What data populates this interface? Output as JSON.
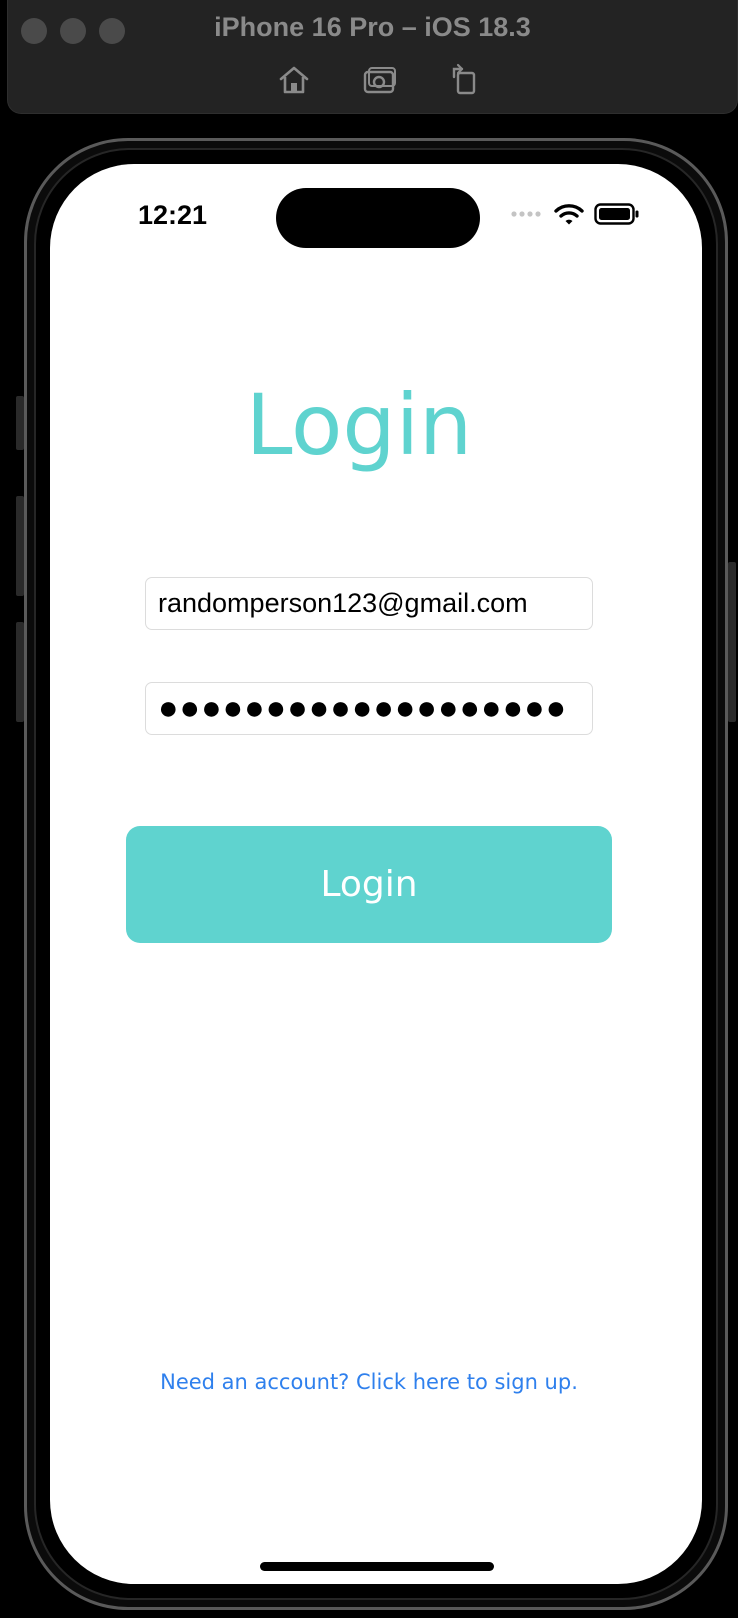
{
  "simulator": {
    "title": "iPhone 16 Pro – iOS 18.3",
    "tools": [
      "home-icon",
      "screenshot-icon",
      "rotate-icon"
    ]
  },
  "status_bar": {
    "time": "12:21",
    "icons": [
      "signal-dots-icon",
      "wifi-icon",
      "battery-icon"
    ]
  },
  "login_screen": {
    "title": "Login",
    "email_value": "randomperson123@gmail.com",
    "password_mask": "●●●●●●●●●●●●●●●●●●●",
    "login_button_label": "Login",
    "signup_link": "Need an account? Click here to sign up."
  },
  "colors": {
    "accent": "#5fd3cf",
    "link": "#2f80ed"
  }
}
